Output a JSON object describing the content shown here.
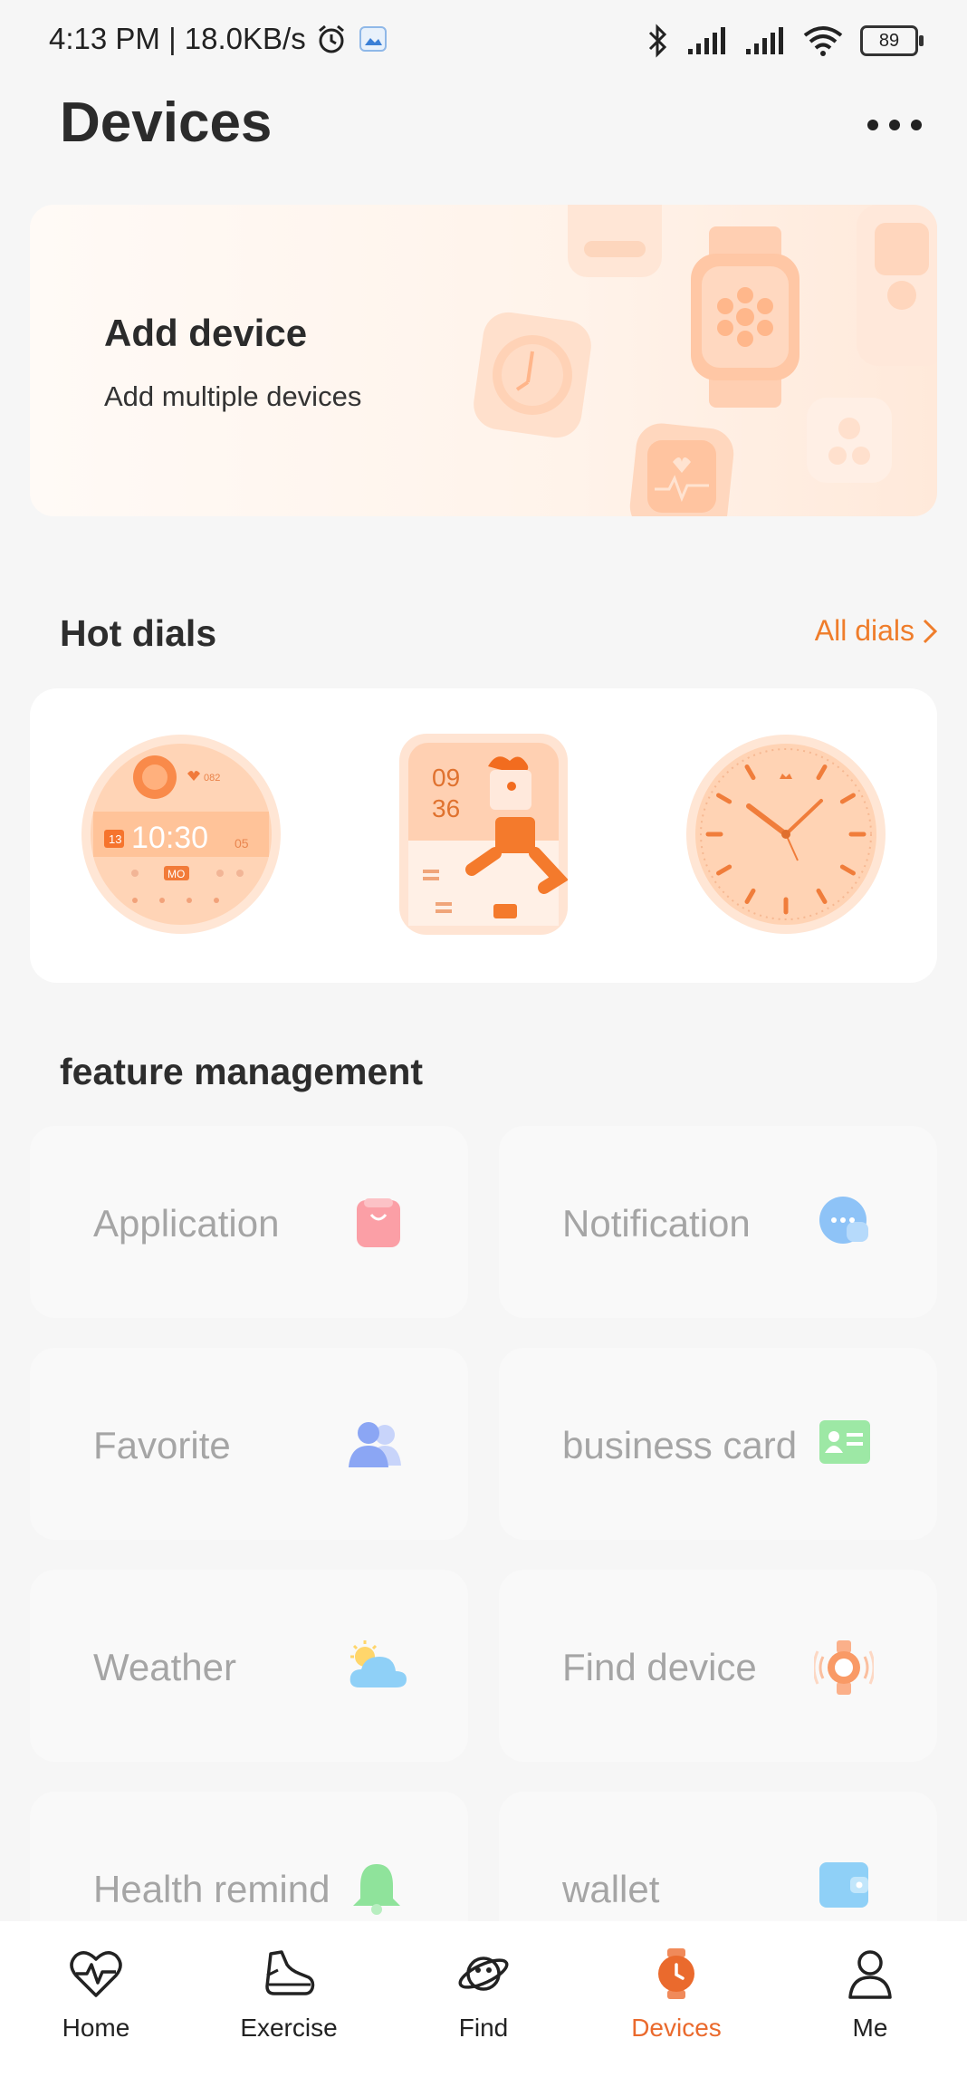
{
  "status_bar": {
    "time_speed": "4:13 PM | 18.0KB/s",
    "battery": "89",
    "icons": [
      "alarm-icon",
      "gallery-icon",
      "bluetooth-icon",
      "signal-icon",
      "signal-icon",
      "wifi-icon",
      "battery-icon"
    ]
  },
  "header": {
    "title": "Devices",
    "more_icon": "more-dots-icon"
  },
  "add_device": {
    "title": "Add device",
    "subtitle": "Add multiple devices"
  },
  "hot_dials": {
    "title": "Hot dials",
    "all_label": "All dials",
    "dial1": {
      "time": "10:30",
      "date": "13",
      "sec": "05",
      "day": "MO",
      "beats": "082"
    },
    "dial2": {
      "hour": "09",
      "minute": "36"
    }
  },
  "features": {
    "title": "feature management",
    "items": [
      {
        "label": "Application",
        "icon": "bag-icon"
      },
      {
        "label": "Notification",
        "icon": "chat-bubble-icon"
      },
      {
        "label": "Favorite",
        "icon": "contacts-icon"
      },
      {
        "label": "business card",
        "icon": "card-icon"
      },
      {
        "label": "Weather",
        "icon": "weather-icon"
      },
      {
        "label": "Find device",
        "icon": "find-watch-icon"
      },
      {
        "label": "Health remind",
        "icon": "bell-icon"
      },
      {
        "label": "wallet",
        "icon": "wallet-icon"
      }
    ]
  },
  "bottom_nav": {
    "items": [
      {
        "label": "Home",
        "icon": "heart-pulse-icon"
      },
      {
        "label": "Exercise",
        "icon": "shoe-icon"
      },
      {
        "label": "Find",
        "icon": "planet-icon"
      },
      {
        "label": "Devices",
        "icon": "watch-icon"
      },
      {
        "label": "Me",
        "icon": "person-icon"
      }
    ],
    "active": "Devices"
  },
  "colors": {
    "accent": "#ef7d2b",
    "active_nav": "#ea6a2d",
    "background": "#f6f6f6"
  }
}
